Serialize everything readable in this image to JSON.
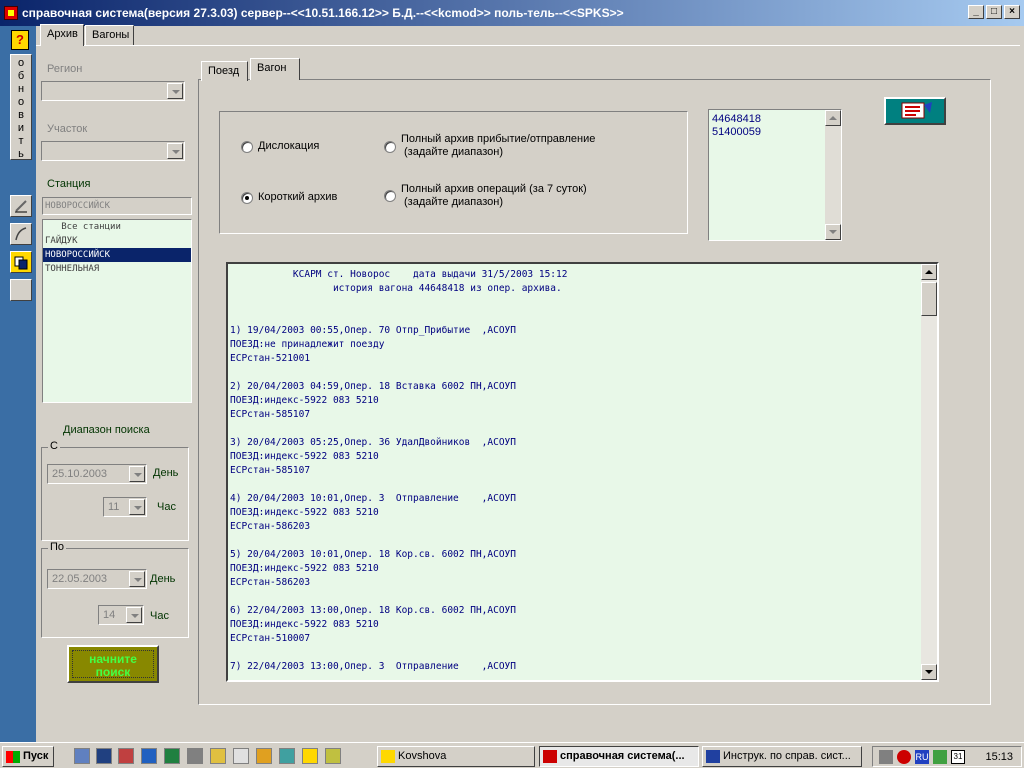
{
  "window": {
    "title": "справочная система(версия 27.3.03) сервер--<<10.51.166.12>> Б.Д.--<<kcmod>> поль-тель--<<SPKS>>",
    "buttons": [
      "_",
      "□",
      "×"
    ]
  },
  "left_toolbar": {
    "help": "?",
    "refresh_label": "обновить"
  },
  "main_tabs": [
    {
      "label": "Архив",
      "active": true
    },
    {
      "label": "Вагоны",
      "active": false
    }
  ],
  "sub_tabs": [
    {
      "label": "Поезд",
      "active": false
    },
    {
      "label": "Вагон",
      "active": true
    }
  ],
  "filters": {
    "region_label": "Регион",
    "region_value": "",
    "section_label": "Участок",
    "section_value": "",
    "station_label": "Станция",
    "station_value": "НОВОРОССИЙСК",
    "stations": [
      {
        "name": "   Все станции",
        "selected": false
      },
      {
        "name": "ГАЙДУК",
        "selected": false
      },
      {
        "name": "НОВОРОССИЙСК",
        "selected": true
      },
      {
        "name": "ТОННЕЛЬНАЯ",
        "selected": false
      }
    ]
  },
  "search_range": {
    "title": "Диапазон поиска",
    "from": {
      "caption": "С",
      "date": "25.10.2003",
      "day_label": "День",
      "hour": "11",
      "hour_label": "Час"
    },
    "to": {
      "caption": "По",
      "date": "22.05.2003",
      "day_label": "День",
      "hour": "14",
      "hour_label": "Час"
    },
    "start_button": "начните поиск"
  },
  "options": [
    {
      "label": "Дислокация",
      "checked": false
    },
    {
      "label": "Полный архив прибытие/отправление\n(задайте диапазон)",
      "checked": false
    },
    {
      "label": "Короткий архив",
      "checked": true
    },
    {
      "label": "Полный архив операций (за 7 суток)\n(задайте диапазон)",
      "checked": false
    }
  ],
  "wagons": [
    "44648418",
    "51400059"
  ],
  "report": {
    "lines": [
      "           КСАРМ ст. Новорос    дата выдачи 31/5/2003 15:12",
      "                  история вагона 44648418 из опер. архива.",
      "",
      "",
      "1) 19/04/2003 00:55,Опер. 70 Отпр_Прибытие  ,АСОУП",
      "ПОЕЗД:не принадлежит поезду",
      "ЕСРстан-521001",
      "",
      "2) 20/04/2003 04:59,Опер. 18 Вставка 6002 ПН,АСОУП",
      "ПОЕЗД:индекс-5922 083 5210",
      "ЕСРстан-585107",
      "",
      "3) 20/04/2003 05:25,Опер. 36 УдалДвойников  ,АСОУП",
      "ПОЕЗД:индекс-5922 083 5210",
      "ЕСРстан-585107",
      "",
      "4) 20/04/2003 10:01,Опер. 3  Отправление    ,АСОУП",
      "ПОЕЗД:индекс-5922 083 5210",
      "ЕСРстан-586203",
      "",
      "5) 20/04/2003 10:01,Опер. 18 Кор.св. 6002 ПН,АСОУП",
      "ПОЕЗД:индекс-5922 083 5210",
      "ЕСРстан-586203",
      "",
      "6) 22/04/2003 13:00,Опер. 18 Кор.св. 6002 ПН,АСОУП",
      "ПОЕЗД:индекс-5922 083 5210",
      "ЕСРстан-510007",
      "",
      "7) 22/04/2003 13:00,Опер. 3  Отправление    ,АСОУП"
    ]
  },
  "taskbar": {
    "start_label": "Пуск",
    "tasks": [
      {
        "label": "Kovshova",
        "active": false
      },
      {
        "label": "справочная система(...",
        "active": true
      },
      {
        "label": "Инструк. по справ. сист...",
        "active": false
      }
    ],
    "lang": "RU",
    "clock": "15:13",
    "calendar_day": "31"
  }
}
